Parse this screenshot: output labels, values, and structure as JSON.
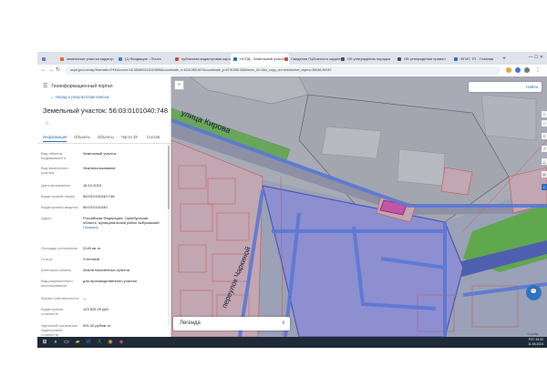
{
  "browser": {
    "tabs": [
      {
        "label": "",
        "color": "#6b7cc4"
      },
      {
        "label": "земельные участки кадастр",
        "color": "#e06a2c"
      },
      {
        "label": "(1) Входящие - Почта",
        "color": "#3a7bd5"
      },
      {
        "label": "публичная кадастровая карта",
        "color": "#d9443a"
      },
      {
        "label": "НСПД - Земельный участок",
        "color": "#2f6fb4"
      },
      {
        "label": "Сведения Публичного кадастра",
        "color": "#d9443a"
      },
      {
        "label": "Об утверждении порядка",
        "color": "#4d4d4d"
      },
      {
        "label": "ОБ утверждении правил",
        "color": "#4d4d4d"
      },
      {
        "label": "ФГИС ТП - Главная",
        "color": "#2f6fb4"
      }
    ],
    "url": "nspd.gov.ru/map?thematic=PKK&zoom=18.384863216415856&coordinate_x=6341985.827&coordinate_y=6741088.35&theme_id=1&is_copy_url=true&active_layers=36048,36049"
  },
  "panel": {
    "brand": "Геоинформационный портал",
    "back_link": "← Назад к результатам поиска",
    "title": "Земельный участок: 56:03:0101040:748",
    "tabs": [
      "Информация",
      "Объекты",
      "Объекты",
      "Части ЗУ",
      "Состав"
    ],
    "fields": [
      {
        "key": "Вид объекта недвижимости",
        "value": "Земельный участок"
      },
      {
        "key": "Вид земельного участка",
        "value": "Землепользование"
      },
      {
        "key": "Дата присвоения",
        "value": "18.12.2015"
      },
      {
        "key": "Кадастровый номер",
        "value": "56:03:0101040:748"
      },
      {
        "key": "Кадастровый квартал",
        "value": "56:03:0101040"
      },
      {
        "key": "Адрес",
        "value": "Российская Федерация, Оренбургская область, муниципальный район Акбулакский",
        "link": "Показать"
      },
      {
        "key": "Площадь уточненная",
        "value": "3149 кв. м"
      },
      {
        "key": "Статус",
        "value": "Учтенный"
      },
      {
        "key": "Категория земель",
        "value": "Земли населенных пунктов"
      },
      {
        "key": "Вид разрешенного использования",
        "value": "для производственного участка"
      },
      {
        "key": "Форма собственности",
        "value": "—"
      },
      {
        "key": "Кадастровая стоимость",
        "value": "123 625,29 руб."
      },
      {
        "key": "Удельный показатель кадастровой стоимости",
        "value": "391,42 руб/кв. м"
      }
    ]
  },
  "map": {
    "search_button": "Найти",
    "legend": "Легенда",
    "street_1": "улица Кирова",
    "street_2": "переулок Чаркиной",
    "attribution": "© НСПД"
  },
  "taskbar": {
    "time": "15:32",
    "date": "11.06.2024",
    "lang": "РУС"
  },
  "colors": {
    "parcel_fill": "#b7b7c9",
    "parcel_stroke": "#d9554f",
    "road_blue": "#5a78d6",
    "green_zone": "#6fbf5a",
    "selected_parcel": "#c43a9e",
    "accent": "#2f6fb4"
  }
}
